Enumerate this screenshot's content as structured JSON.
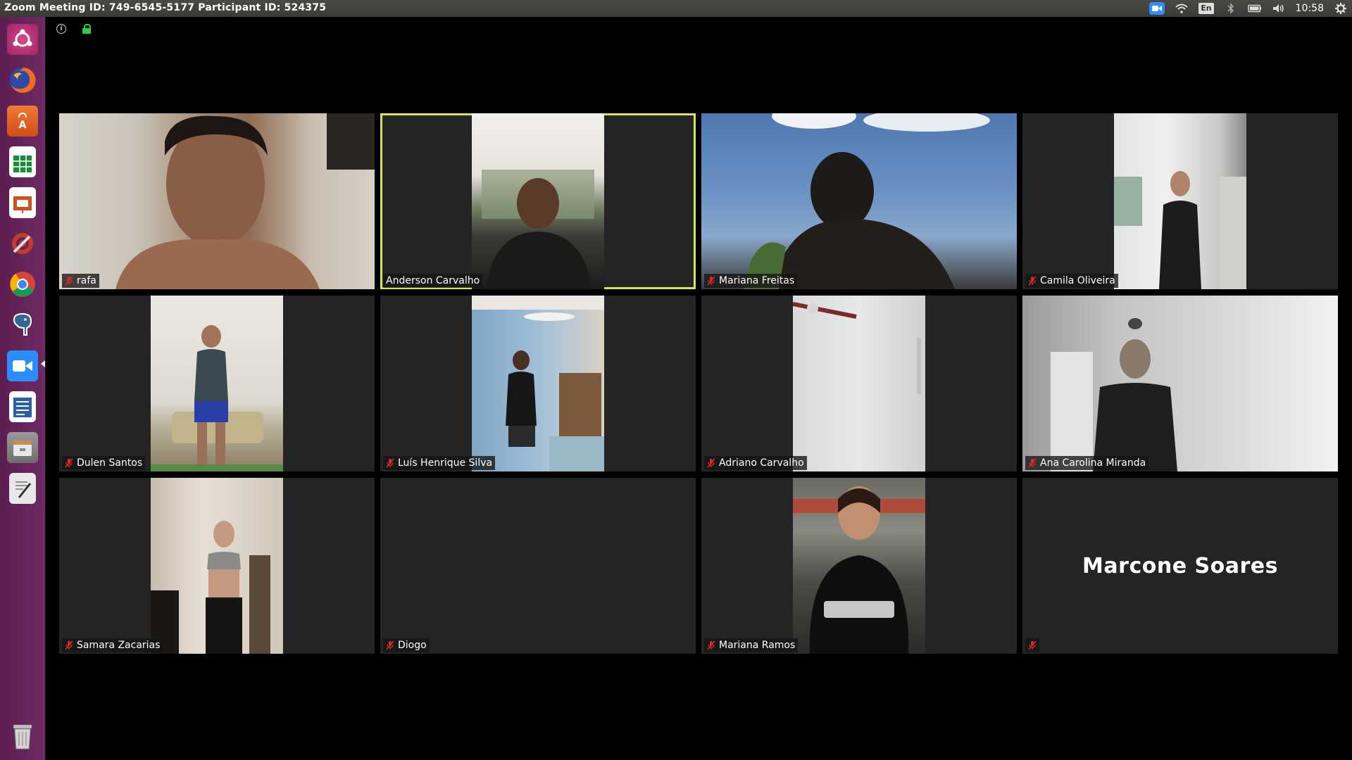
{
  "topbar": {
    "title": "Zoom Meeting ID: 749-6545-5177 Participant ID: 524375",
    "time": "10:58",
    "keyboard_layout": "En"
  },
  "launcher": {
    "items": [
      {
        "name": "ubuntu-dash-icon",
        "color": "#c0337a"
      },
      {
        "name": "firefox-icon",
        "color": "#e66000"
      },
      {
        "name": "software-center-icon",
        "color": "#e8662d"
      },
      {
        "name": "calc-spreadsheet-icon",
        "color": "#1e8a3a"
      },
      {
        "name": "impress-presentation-icon",
        "color": "#d04f1e"
      },
      {
        "name": "system-settings-icon",
        "color": "#c33b2b"
      },
      {
        "name": "chrome-icon",
        "color": "#4285f4"
      },
      {
        "name": "postgres-elephant-icon",
        "color": "#336791"
      },
      {
        "name": "zoom-icon",
        "color": "#2d8cff"
      },
      {
        "name": "writer-document-icon",
        "color": "#2a5faa"
      },
      {
        "name": "files-icon",
        "color": "#8a8a8a"
      },
      {
        "name": "text-editor-icon",
        "color": "#9a9a9a"
      },
      {
        "name": "trash-icon",
        "color": "#8c8c8c"
      }
    ]
  },
  "participants": [
    {
      "name": "rafa",
      "muted": true
    },
    {
      "name": "Anderson Carvalho",
      "muted": false,
      "speaking": true
    },
    {
      "name": "Mariana Freitas",
      "muted": true
    },
    {
      "name": "Camila Oliveira",
      "muted": true
    },
    {
      "name": "Dulen Santos",
      "muted": true
    },
    {
      "name": "Luís Henrique Silva",
      "muted": true
    },
    {
      "name": "Adriano Carvalho",
      "muted": true
    },
    {
      "name": "Ana Carolina Miranda",
      "muted": true
    },
    {
      "name": "Samara Zacarias",
      "muted": true
    },
    {
      "name": "Diogo",
      "muted": true
    },
    {
      "name": "Mariana Ramos",
      "muted": true
    },
    {
      "name": "Marcone Soares",
      "muted": true,
      "video_off": true
    }
  ],
  "colors": {
    "active_speaker_border": "#d6e25a",
    "mute_icon": "#e02828",
    "tile_bg": "#242424"
  }
}
